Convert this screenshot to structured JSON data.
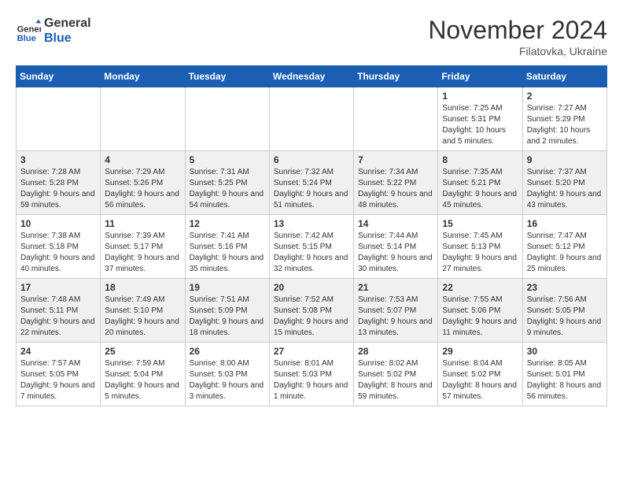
{
  "header": {
    "logo_general": "General",
    "logo_blue": "Blue",
    "month_year": "November 2024",
    "location": "Filatovka, Ukraine"
  },
  "calendar": {
    "days_of_week": [
      "Sunday",
      "Monday",
      "Tuesday",
      "Wednesday",
      "Thursday",
      "Friday",
      "Saturday"
    ],
    "weeks": [
      [
        {
          "day": "",
          "info": ""
        },
        {
          "day": "",
          "info": ""
        },
        {
          "day": "",
          "info": ""
        },
        {
          "day": "",
          "info": ""
        },
        {
          "day": "",
          "info": ""
        },
        {
          "day": "1",
          "info": "Sunrise: 7:25 AM\nSunset: 5:31 PM\nDaylight: 10 hours and 5 minutes."
        },
        {
          "day": "2",
          "info": "Sunrise: 7:27 AM\nSunset: 5:29 PM\nDaylight: 10 hours and 2 minutes."
        }
      ],
      [
        {
          "day": "3",
          "info": "Sunrise: 7:28 AM\nSunset: 5:28 PM\nDaylight: 9 hours and 59 minutes."
        },
        {
          "day": "4",
          "info": "Sunrise: 7:29 AM\nSunset: 5:26 PM\nDaylight: 9 hours and 56 minutes."
        },
        {
          "day": "5",
          "info": "Sunrise: 7:31 AM\nSunset: 5:25 PM\nDaylight: 9 hours and 54 minutes."
        },
        {
          "day": "6",
          "info": "Sunrise: 7:32 AM\nSunset: 5:24 PM\nDaylight: 9 hours and 51 minutes."
        },
        {
          "day": "7",
          "info": "Sunrise: 7:34 AM\nSunset: 5:22 PM\nDaylight: 9 hours and 48 minutes."
        },
        {
          "day": "8",
          "info": "Sunrise: 7:35 AM\nSunset: 5:21 PM\nDaylight: 9 hours and 45 minutes."
        },
        {
          "day": "9",
          "info": "Sunrise: 7:37 AM\nSunset: 5:20 PM\nDaylight: 9 hours and 43 minutes."
        }
      ],
      [
        {
          "day": "10",
          "info": "Sunrise: 7:38 AM\nSunset: 5:18 PM\nDaylight: 9 hours and 40 minutes."
        },
        {
          "day": "11",
          "info": "Sunrise: 7:39 AM\nSunset: 5:17 PM\nDaylight: 9 hours and 37 minutes."
        },
        {
          "day": "12",
          "info": "Sunrise: 7:41 AM\nSunset: 5:16 PM\nDaylight: 9 hours and 35 minutes."
        },
        {
          "day": "13",
          "info": "Sunrise: 7:42 AM\nSunset: 5:15 PM\nDaylight: 9 hours and 32 minutes."
        },
        {
          "day": "14",
          "info": "Sunrise: 7:44 AM\nSunset: 5:14 PM\nDaylight: 9 hours and 30 minutes."
        },
        {
          "day": "15",
          "info": "Sunrise: 7:45 AM\nSunset: 5:13 PM\nDaylight: 9 hours and 27 minutes."
        },
        {
          "day": "16",
          "info": "Sunrise: 7:47 AM\nSunset: 5:12 PM\nDaylight: 9 hours and 25 minutes."
        }
      ],
      [
        {
          "day": "17",
          "info": "Sunrise: 7:48 AM\nSunset: 5:11 PM\nDaylight: 9 hours and 22 minutes."
        },
        {
          "day": "18",
          "info": "Sunrise: 7:49 AM\nSunset: 5:10 PM\nDaylight: 9 hours and 20 minutes."
        },
        {
          "day": "19",
          "info": "Sunrise: 7:51 AM\nSunset: 5:09 PM\nDaylight: 9 hours and 18 minutes."
        },
        {
          "day": "20",
          "info": "Sunrise: 7:52 AM\nSunset: 5:08 PM\nDaylight: 9 hours and 15 minutes."
        },
        {
          "day": "21",
          "info": "Sunrise: 7:53 AM\nSunset: 5:07 PM\nDaylight: 9 hours and 13 minutes."
        },
        {
          "day": "22",
          "info": "Sunrise: 7:55 AM\nSunset: 5:06 PM\nDaylight: 9 hours and 11 minutes."
        },
        {
          "day": "23",
          "info": "Sunrise: 7:56 AM\nSunset: 5:05 PM\nDaylight: 9 hours and 9 minutes."
        }
      ],
      [
        {
          "day": "24",
          "info": "Sunrise: 7:57 AM\nSunset: 5:05 PM\nDaylight: 9 hours and 7 minutes."
        },
        {
          "day": "25",
          "info": "Sunrise: 7:59 AM\nSunset: 5:04 PM\nDaylight: 9 hours and 5 minutes."
        },
        {
          "day": "26",
          "info": "Sunrise: 8:00 AM\nSunset: 5:03 PM\nDaylight: 9 hours and 3 minutes."
        },
        {
          "day": "27",
          "info": "Sunrise: 8:01 AM\nSunset: 5:03 PM\nDaylight: 9 hours and 1 minute."
        },
        {
          "day": "28",
          "info": "Sunrise: 8:02 AM\nSunset: 5:02 PM\nDaylight: 8 hours and 59 minutes."
        },
        {
          "day": "29",
          "info": "Sunrise: 8:04 AM\nSunset: 5:02 PM\nDaylight: 8 hours and 57 minutes."
        },
        {
          "day": "30",
          "info": "Sunrise: 8:05 AM\nSunset: 5:01 PM\nDaylight: 8 hours and 56 minutes."
        }
      ]
    ]
  }
}
